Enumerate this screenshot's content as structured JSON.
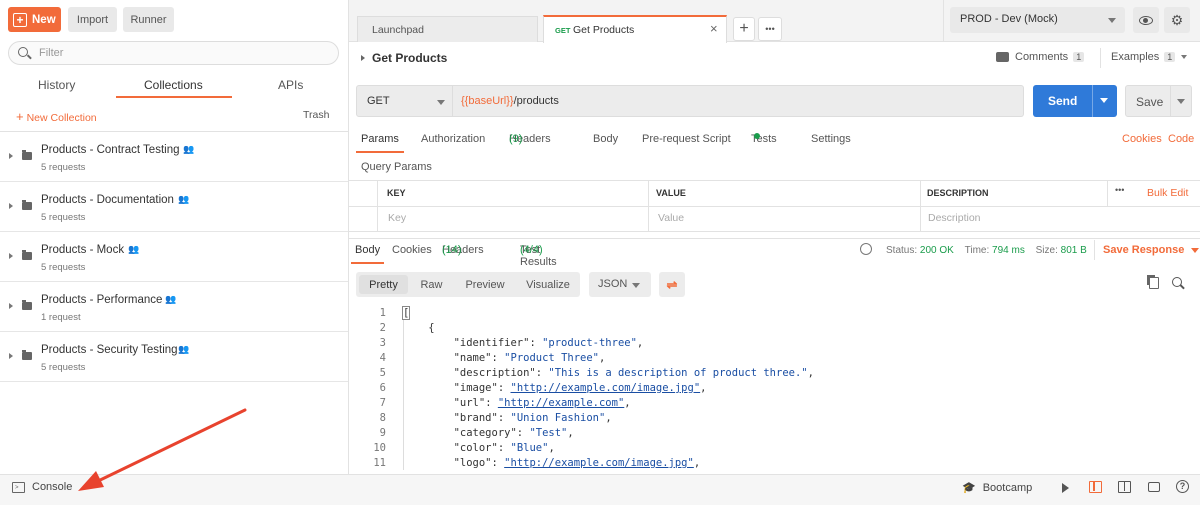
{
  "toolbar": {
    "new_label": "New",
    "import_label": "Import",
    "runner_label": "Runner"
  },
  "sidebar": {
    "filter_placeholder": "Filter",
    "tabs": [
      "History",
      "Collections",
      "APIs"
    ],
    "new_collection": "New Collection",
    "trash": "Trash",
    "collections": [
      {
        "name": "Products - Contract Testing",
        "requests": "5 requests"
      },
      {
        "name": "Products - Documentation",
        "requests": "5 requests"
      },
      {
        "name": "Products - Mock",
        "requests": "5 requests"
      },
      {
        "name": "Products - Performance",
        "requests": "1 request"
      },
      {
        "name": "Products - Security Testing",
        "requests": "5 requests"
      }
    ]
  },
  "tabs": {
    "launchpad": "Launchpad",
    "active_method": "GET",
    "active_name": "Get Products",
    "add": "+",
    "more": "•••"
  },
  "environment": {
    "selected": "PROD - Dev (Mock)"
  },
  "request": {
    "title": "Get Products",
    "comments_label": "Comments",
    "comments_count": "1",
    "examples_label": "Examples",
    "examples_count": "1",
    "method": "GET",
    "url_var": "{{baseUrl}}",
    "url_path": "/products",
    "send": "Send",
    "save": "Save",
    "tabs": {
      "params": "Params",
      "authorization": "Authorization",
      "headers": "Headers",
      "headers_count": "(9)",
      "body": "Body",
      "prerequest": "Pre-request Script",
      "tests": "Tests",
      "settings": "Settings"
    },
    "cookies": "Cookies",
    "code": "Code",
    "query_params": "Query Params",
    "columns": {
      "key": "KEY",
      "value": "VALUE",
      "description": "DESCRIPTION"
    },
    "bulk_edit": "Bulk Edit",
    "placeholders": {
      "key": "Key",
      "value": "Value",
      "description": "Description"
    }
  },
  "response": {
    "tabs": {
      "body": "Body",
      "cookies": "Cookies",
      "headers": "Headers",
      "headers_count": "(14)",
      "tests": "Test Results",
      "tests_count": "(4/4)"
    },
    "status_label": "Status:",
    "status": "200 OK",
    "time_label": "Time:",
    "time": "794 ms",
    "size_label": "Size:",
    "size": "801 B",
    "save_response": "Save Response",
    "views": [
      "Pretty",
      "Raw",
      "Preview",
      "Visualize"
    ],
    "format": "JSON",
    "lines": [
      {
        "n": "1",
        "text": "["
      },
      {
        "n": "2",
        "text": "    {"
      },
      {
        "n": "3",
        "key": "\"identifier\"",
        "value": "\"product-three\"",
        "link": false
      },
      {
        "n": "4",
        "key": "\"name\"",
        "value": "\"Product Three\"",
        "link": false
      },
      {
        "n": "5",
        "key": "\"description\"",
        "value": "\"This is a description of product three.\"",
        "link": false
      },
      {
        "n": "6",
        "key": "\"image\"",
        "value": "\"http://example.com/image.jpg\"",
        "link": true
      },
      {
        "n": "7",
        "key": "\"url\"",
        "value": "\"http://example.com\"",
        "link": true
      },
      {
        "n": "8",
        "key": "\"brand\"",
        "value": "\"Union Fashion\"",
        "link": false
      },
      {
        "n": "9",
        "key": "\"category\"",
        "value": "\"Test\"",
        "link": false
      },
      {
        "n": "10",
        "key": "\"color\"",
        "value": "\"Blue\"",
        "link": false
      },
      {
        "n": "11",
        "key": "\"logo\"",
        "value": "\"http://example.com/image.jpg\"",
        "link": true
      }
    ]
  },
  "statusbar": {
    "console": "Console",
    "bootcamp": "Bootcamp"
  },
  "colors": {
    "accent": "#f26b3a",
    "send": "#2f7ad9",
    "ok": "#1a9c4b"
  }
}
